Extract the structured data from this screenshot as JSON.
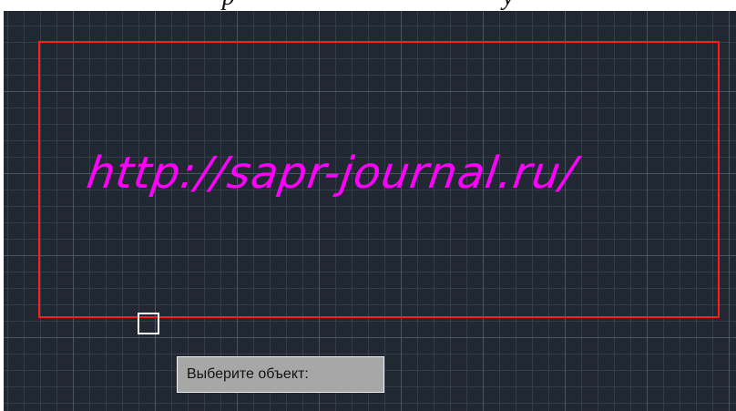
{
  "caption": {
    "visible_text": "р                                          у"
  },
  "canvas": {
    "background_color": "#212832",
    "grid": true,
    "grid_major_color": "#5d6776",
    "grid_minor_color": "#373f4c"
  },
  "drawing": {
    "rectangle_color": "#ff1c1c",
    "text": "http://sapr-journal.ru/",
    "text_color": "#ff00ff"
  },
  "cursor": {
    "type": "pickbox",
    "color": "#ffffff"
  },
  "prompt": {
    "label": "Выберите объект:",
    "background_color": "#a7a7a7"
  }
}
